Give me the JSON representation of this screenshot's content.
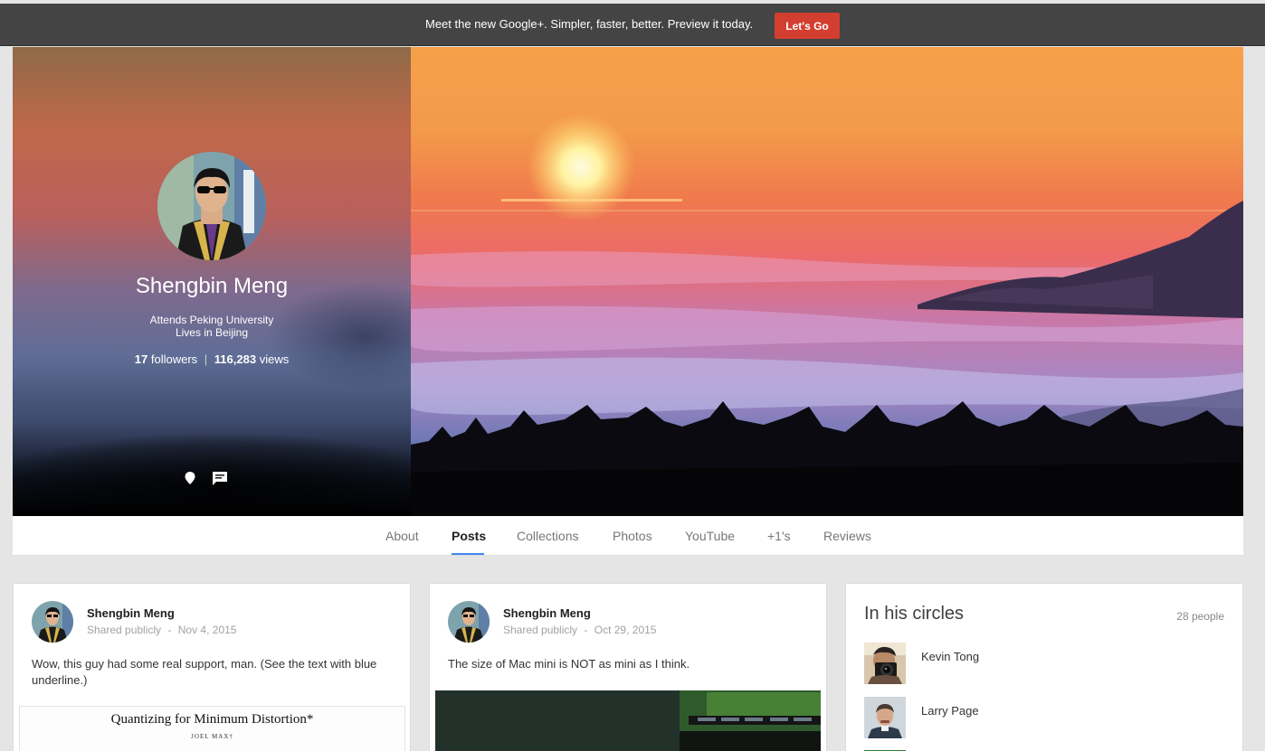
{
  "promo": {
    "message": "Meet the new Google+.   Simpler, faster, better. Preview it today.",
    "button_label": "Let's Go"
  },
  "profile": {
    "name": "Shengbin Meng",
    "education": "Attends Peking University",
    "location": "Lives in Beijing",
    "followers_count": "17",
    "followers_label": "followers",
    "views_count": "116,283",
    "views_label": "views",
    "actions": [
      {
        "icon": "location-pin-icon"
      },
      {
        "icon": "message-icon"
      }
    ]
  },
  "tabs": [
    {
      "label": "About",
      "active": false
    },
    {
      "label": "Posts",
      "active": true
    },
    {
      "label": "Collections",
      "active": false
    },
    {
      "label": "Photos",
      "active": false
    },
    {
      "label": "YouTube",
      "active": false
    },
    {
      "label": "+1's",
      "active": false
    },
    {
      "label": "Reviews",
      "active": false
    }
  ],
  "posts": [
    {
      "author": "Shengbin Meng",
      "visibility": "Shared publicly",
      "separator": "-",
      "date": "Nov 4, 2015",
      "text": "Wow, this guy had some real support, man. (See the text with blue underline.)",
      "attachment": {
        "title": "Quantizing for Minimum Distortion*",
        "author": "JOEL MAX†"
      }
    },
    {
      "author": "Shengbin Meng",
      "visibility": "Shared publicly",
      "separator": "-",
      "date": "Oct 29, 2015",
      "text": "The size of Mac mini is NOT as mini as I think."
    }
  ],
  "circles": {
    "title": "In his circles",
    "count_label": "28 people",
    "people": [
      {
        "name": "Kevin Tong"
      },
      {
        "name": "Larry Page"
      }
    ]
  },
  "colors": {
    "promo_bg": "#444444",
    "promo_button": "#d23f31",
    "tab_underline": "#4285f4",
    "page_bg": "#e5e5e5"
  }
}
